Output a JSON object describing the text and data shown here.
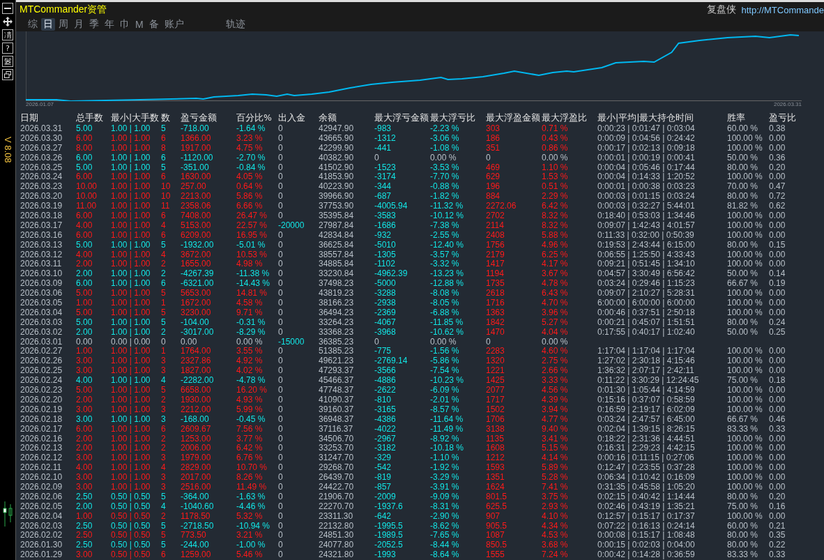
{
  "window": {
    "title": "MTCommander资管",
    "brand": "复盘侠",
    "url": "http://MTCommande"
  },
  "side_toolbar": {
    "buttons": [
      {
        "kind": "minimize"
      },
      {
        "kind": "move"
      },
      {
        "kind": "glyph",
        "label": "凊"
      },
      {
        "kind": "glyph",
        "label": "?"
      },
      {
        "kind": "glyph",
        "label": "鬉"
      },
      {
        "kind": "window"
      }
    ],
    "version": "V 8.08"
  },
  "tabs": [
    {
      "label": "综",
      "selected": false
    },
    {
      "label": "日",
      "selected": true
    },
    {
      "label": "周",
      "selected": false
    },
    {
      "label": "月",
      "selected": false
    },
    {
      "label": "季",
      "selected": false
    },
    {
      "label": "年",
      "selected": false
    },
    {
      "label": "巾",
      "selected": false
    },
    {
      "label": "M",
      "selected": false
    },
    {
      "label": "备",
      "selected": false
    },
    {
      "label": "账户",
      "selected": false
    },
    {
      "label": "轨迹",
      "selected": false
    }
  ],
  "chart": {
    "start_label": "2026.01.07",
    "end_label": "2026.03.31"
  },
  "table": {
    "columns": [
      "日期",
      "总手数",
      "最小|大手数",
      "数",
      "盈亏金额",
      "百分比%",
      "出入金",
      "余额",
      "最大浮亏金额",
      "最大浮亏比",
      "最大浮盈金额",
      "最大浮盈比",
      "最小|平均|最大持仓时间",
      "胜率",
      "盈亏比"
    ],
    "rows": [
      {
        "kind": "loss",
        "transfer": false,
        "floating": true,
        "cells": [
          "2026.03.31",
          "5.00",
          "1.00 | 1.00",
          "5",
          "-718.00",
          "-1.64 %",
          "0",
          "42947.90",
          "-983",
          "-2.23 %",
          "303",
          "0.71 %",
          "0:00:23 | 0:01:47 | 0:03:04",
          "60.00 %",
          "0.38"
        ]
      },
      {
        "kind": "profit",
        "transfer": false,
        "floating": true,
        "cells": [
          "2026.03.30",
          "6.00",
          "1.00 | 1.00",
          "6",
          "1366.00",
          "3.23 %",
          "0",
          "43665.90",
          "-1312",
          "-3.06 %",
          "186",
          "0.43 %",
          "0:00:09 | 0:04:56 | 0:24:42",
          "100.00 %",
          "0.00"
        ]
      },
      {
        "kind": "profit",
        "transfer": false,
        "floating": true,
        "cells": [
          "2026.03.27",
          "8.00",
          "1.00 | 1.00",
          "8",
          "1917.00",
          "4.75 %",
          "0",
          "42299.90",
          "-441",
          "-1.08 %",
          "351",
          "0.86 %",
          "0:00:17 | 0:02:13 | 0:09:18",
          "100.00 %",
          "0.00"
        ]
      },
      {
        "kind": "loss",
        "transfer": false,
        "floating": false,
        "cells": [
          "2026.03.26",
          "6.00",
          "1.00 | 1.00",
          "6",
          "-1120.00",
          "-2.70 %",
          "0",
          "40382.90",
          "0",
          "0.00 %",
          "0",
          "0.00 %",
          "0:00:01 | 0:00:19 | 0:00:41",
          "50.00 %",
          "0.36"
        ]
      },
      {
        "kind": "loss",
        "transfer": false,
        "floating": true,
        "cells": [
          "2026.03.25",
          "5.00",
          "1.00 | 1.00",
          "5",
          "-351.00",
          "-0.84 %",
          "0",
          "41502.90",
          "-1523",
          "-3.53 %",
          "469",
          "1.10 %",
          "0:00:04 | 0:05:46 | 0:17:44",
          "80.00 %",
          "0.20"
        ]
      },
      {
        "kind": "profit",
        "transfer": false,
        "floating": true,
        "cells": [
          "2026.03.24",
          "6.00",
          "1.00 | 1.00",
          "6",
          "1630.00",
          "4.05 %",
          "0",
          "41853.90",
          "-3174",
          "-7.70 %",
          "629",
          "1.53 %",
          "0:00:04 | 0:14:33 | 1:20:52",
          "100.00 %",
          "0.00"
        ]
      },
      {
        "kind": "profit",
        "transfer": false,
        "floating": true,
        "cells": [
          "2026.03.23",
          "10.00",
          "1.00 | 1.00",
          "10",
          "257.00",
          "0.64 %",
          "0",
          "40223.90",
          "-344",
          "-0.88 %",
          "196",
          "0.51 %",
          "0:00:01 | 0:00:38 | 0:03:23",
          "70.00 %",
          "0.47"
        ]
      },
      {
        "kind": "profit",
        "transfer": false,
        "floating": true,
        "cells": [
          "2026.03.20",
          "10.00",
          "1.00 | 1.00",
          "10",
          "2213.00",
          "5.86 %",
          "0",
          "39966.90",
          "-687",
          "-1.82 %",
          "884",
          "2.29 %",
          "0:00:03 | 0:01:15 | 0:03:24",
          "80.00 %",
          "0.72"
        ]
      },
      {
        "kind": "profit",
        "transfer": false,
        "floating": true,
        "cells": [
          "2026.03.19",
          "11.00",
          "1.00 | 1.00",
          "11",
          "2358.06",
          "6.66 %",
          "0",
          "37753.90",
          "-4005.94",
          "-11.32 %",
          "2272.06",
          "6.42 %",
          "0:00:03 | 0:32:27 | 5:44:01",
          "81.82 %",
          "0.62"
        ]
      },
      {
        "kind": "profit",
        "transfer": false,
        "floating": true,
        "cells": [
          "2026.03.18",
          "6.00",
          "1.00 | 1.00",
          "6",
          "7408.00",
          "26.47 %",
          "0",
          "35395.84",
          "-3583",
          "-10.12 %",
          "2702",
          "8.32 %",
          "0:18:40 | 0:53:03 | 1:34:46",
          "100.00 %",
          "0.00"
        ]
      },
      {
        "kind": "profit",
        "transfer": true,
        "floating": true,
        "cells": [
          "2026.03.17",
          "4.00",
          "1.00 | 1.00",
          "4",
          "5153.00",
          "22.57 %",
          "-20000",
          "27987.84",
          "-1686",
          "-7.38 %",
          "2114",
          "8.32 %",
          "0:09:07 | 1:42:43 | 4:01:57",
          "100.00 %",
          "0.00"
        ]
      },
      {
        "kind": "profit",
        "transfer": false,
        "floating": true,
        "cells": [
          "2026.03.16",
          "6.00",
          "1.00 | 1.00",
          "6",
          "6209.00",
          "16.95 %",
          "0",
          "42834.84",
          "-932",
          "-2.55 %",
          "2408",
          "5.88 %",
          "0:11:33 | 0:32:00 | 0:50:39",
          "100.00 %",
          "0.00"
        ]
      },
      {
        "kind": "loss",
        "transfer": false,
        "floating": true,
        "cells": [
          "2026.03.13",
          "5.00",
          "1.00 | 1.00",
          "5",
          "-1932.00",
          "-5.01 %",
          "0",
          "36625.84",
          "-5010",
          "-12.40 %",
          "1756",
          "4.96 %",
          "0:19:53 | 2:43:44 | 6:15:00",
          "80.00 %",
          "0.15"
        ]
      },
      {
        "kind": "profit",
        "transfer": false,
        "floating": true,
        "cells": [
          "2026.03.12",
          "4.00",
          "1.00 | 1.00",
          "4",
          "3672.00",
          "10.53 %",
          "0",
          "38557.84",
          "-1305",
          "-3.57 %",
          "2179",
          "6.25 %",
          "0:06:55 | 1:25:50 | 4:33:43",
          "100.00 %",
          "0.00"
        ]
      },
      {
        "kind": "profit",
        "transfer": false,
        "floating": true,
        "cells": [
          "2026.03.11",
          "2.00",
          "1.00 | 1.00",
          "2",
          "1655.00",
          "4.98 %",
          "0",
          "34885.84",
          "-1102",
          "-3.32 %",
          "1417",
          "4.17 %",
          "0:09:21 | 0:51:45 | 1:34:10",
          "100.00 %",
          "0.00"
        ]
      },
      {
        "kind": "loss",
        "transfer": false,
        "floating": true,
        "cells": [
          "2026.03.10",
          "2.00",
          "1.00 | 1.00",
          "2",
          "-4267.39",
          "-11.38 %",
          "0",
          "33230.84",
          "-4962.39",
          "-13.23 %",
          "1194",
          "3.67 %",
          "0:04:57 | 3:30:49 | 6:56:42",
          "50.00 %",
          "0.14"
        ]
      },
      {
        "kind": "loss",
        "transfer": false,
        "floating": true,
        "cells": [
          "2026.03.09",
          "6.00",
          "1.00 | 1.00",
          "6",
          "-6321.00",
          "-14.43 %",
          "0",
          "37498.23",
          "-5000",
          "-12.88 %",
          "1735",
          "4.78 %",
          "0:03:24 | 0:29:46 | 1:15:23",
          "66.67 %",
          "0.19"
        ]
      },
      {
        "kind": "profit",
        "transfer": false,
        "floating": true,
        "cells": [
          "2026.03.06",
          "5.00",
          "1.00 | 1.00",
          "5",
          "5653.00",
          "14.81 %",
          "0",
          "43819.23",
          "-3288",
          "-8.08 %",
          "2618",
          "6.43 %",
          "0:09:07 | 2:10:27 | 5:28:31",
          "100.00 %",
          "0.00"
        ]
      },
      {
        "kind": "profit",
        "transfer": false,
        "floating": true,
        "cells": [
          "2026.03.05",
          "1.00",
          "1.00 | 1.00",
          "1",
          "1672.00",
          "4.58 %",
          "0",
          "38166.23",
          "-2938",
          "-8.05 %",
          "1716",
          "4.70 %",
          "6:00:00 | 6:00:00 | 6:00:00",
          "100.00 %",
          "0.00"
        ]
      },
      {
        "kind": "profit",
        "transfer": false,
        "floating": true,
        "cells": [
          "2026.03.04",
          "5.00",
          "1.00 | 1.00",
          "5",
          "3230.00",
          "9.71 %",
          "0",
          "36494.23",
          "-2369",
          "-6.88 %",
          "1363",
          "3.96 %",
          "0:00:46 | 0:37:51 | 2:50:18",
          "100.00 %",
          "0.00"
        ]
      },
      {
        "kind": "loss",
        "transfer": false,
        "floating": true,
        "cells": [
          "2026.03.03",
          "5.00",
          "1.00 | 1.00",
          "5",
          "-104.00",
          "-0.31 %",
          "0",
          "33264.23",
          "-4067",
          "-11.85 %",
          "1842",
          "5.27 %",
          "0:00:21 | 0:45:07 | 1:51:51",
          "80.00 %",
          "0.24"
        ]
      },
      {
        "kind": "loss",
        "transfer": false,
        "floating": true,
        "cells": [
          "2026.03.02",
          "2.00",
          "1.00 | 1.00",
          "2",
          "-3017.00",
          "-8.29 %",
          "0",
          "33368.23",
          "-3968",
          "-10.62 %",
          "1470",
          "4.04 %",
          "0:17:55 | 0:40:17 | 1:02:40",
          "50.00 %",
          "0.25"
        ]
      },
      {
        "kind": "flat",
        "transfer": true,
        "floating": false,
        "cells": [
          "2026.03.01",
          "0.00",
          "0.00 | 0.00",
          "0",
          "0.00",
          "0.00 %",
          "-15000",
          "36385.23",
          "0",
          "0.00 %",
          "0",
          "0.00 %"
        ]
      },
      {
        "kind": "profit",
        "transfer": false,
        "floating": true,
        "cells": [
          "2026.02.27",
          "1.00",
          "1.00 | 1.00",
          "1",
          "1764.00",
          "3.55 %",
          "0",
          "51385.23",
          "-775",
          "-1.56 %",
          "2283",
          "4.60 %",
          "1:17:04 | 1:17:04 | 1:17:04",
          "100.00 %",
          "0.00"
        ]
      },
      {
        "kind": "profit",
        "transfer": false,
        "floating": true,
        "cells": [
          "2026.02.26",
          "3.00",
          "1.00 | 1.00",
          "3",
          "2327.86",
          "4.92 %",
          "0",
          "49621.23",
          "-2769.14",
          "-5.86 %",
          "1320",
          "2.75 %",
          "1:27:02 | 2:30:18 | 4:15:46",
          "100.00 %",
          "0.00"
        ]
      },
      {
        "kind": "profit",
        "transfer": false,
        "floating": true,
        "cells": [
          "2026.02.25",
          "3.00",
          "1.00 | 1.00",
          "3",
          "1827.00",
          "4.02 %",
          "0",
          "47293.37",
          "-3566",
          "-7.54 %",
          "1221",
          "2.66 %",
          "1:36:32 | 2:07:17 | 2:42:11",
          "100.00 %",
          "0.00"
        ]
      },
      {
        "kind": "loss",
        "transfer": false,
        "floating": true,
        "cells": [
          "2026.02.24",
          "4.00",
          "1.00 | 1.00",
          "4",
          "-2282.00",
          "-4.78 %",
          "0",
          "45466.37",
          "-4886",
          "-10.23 %",
          "1425",
          "3.33 %",
          "0:11:22 | 3:30:29 | 12:24:45",
          "75.00 %",
          "0.18"
        ]
      },
      {
        "kind": "profit",
        "transfer": false,
        "floating": true,
        "cells": [
          "2026.02.23",
          "5.00",
          "1.00 | 1.00",
          "5",
          "6658.00",
          "16.20 %",
          "0",
          "47748.37",
          "-2622",
          "-6.09 %",
          "2077",
          "4.56 %",
          "0:01:30 | 1:05:44 | 4:14:59",
          "100.00 %",
          "0.00"
        ]
      },
      {
        "kind": "profit",
        "transfer": false,
        "floating": true,
        "cells": [
          "2026.02.20",
          "2.00",
          "1.00 | 1.00",
          "2",
          "1930.00",
          "4.93 %",
          "0",
          "41090.37",
          "-810",
          "-2.01 %",
          "1717",
          "4.39 %",
          "0:15:16 | 0:37:07 | 0:58:59",
          "100.00 %",
          "0.00"
        ]
      },
      {
        "kind": "profit",
        "transfer": false,
        "floating": true,
        "cells": [
          "2026.02.19",
          "3.00",
          "1.00 | 1.00",
          "3",
          "2212.00",
          "5.99 %",
          "0",
          "39160.37",
          "-3165",
          "-8.57 %",
          "1502",
          "3.94 %",
          "0:16:59 | 2:19:17 | 6:02:09",
          "100.00 %",
          "0.00"
        ]
      },
      {
        "kind": "loss",
        "transfer": false,
        "floating": true,
        "cells": [
          "2026.02.18",
          "3.00",
          "1.00 | 1.00",
          "3",
          "-168.00",
          "-0.45 %",
          "0",
          "36948.37",
          "-4386",
          "-11.64 %",
          "1706",
          "4.77 %",
          "0:03:24 | 2:47:57 | 6:45:00",
          "66.67 %",
          "0.46"
        ]
      },
      {
        "kind": "profit",
        "transfer": false,
        "floating": true,
        "cells": [
          "2026.02.17",
          "6.00",
          "1.00 | 1.00",
          "6",
          "2609.67",
          "7.56 %",
          "0",
          "37116.37",
          "-4022",
          "-11.49 %",
          "3138",
          "9.40 %",
          "0:02:04 | 1:39:15 | 8:26:15",
          "83.33 %",
          "0.33"
        ]
      },
      {
        "kind": "profit",
        "transfer": false,
        "floating": true,
        "cells": [
          "2026.02.16",
          "2.00",
          "1.00 | 1.00",
          "2",
          "1253.00",
          "3.77 %",
          "0",
          "34506.70",
          "-2967",
          "-8.92 %",
          "1135",
          "3.41 %",
          "0:18:22 | 2:31:36 | 4:44:51",
          "100.00 %",
          "0.00"
        ]
      },
      {
        "kind": "profit",
        "transfer": false,
        "floating": true,
        "cells": [
          "2026.02.13",
          "2.00",
          "1.00 | 1.00",
          "2",
          "2006.00",
          "6.42 %",
          "0",
          "33253.70",
          "-3182",
          "-10.18 %",
          "1608",
          "5.15 %",
          "0:16:31 | 2:29:23 | 4:42:15",
          "100.00 %",
          "0.00"
        ]
      },
      {
        "kind": "profit",
        "transfer": false,
        "floating": true,
        "cells": [
          "2026.02.12",
          "3.00",
          "1.00 | 1.00",
          "3",
          "1979.00",
          "6.76 %",
          "0",
          "31247.70",
          "-329",
          "-1.10 %",
          "1212",
          "4.14 %",
          "0:00:16 | 0:11:15 | 0:27:06",
          "100.00 %",
          "0.00"
        ]
      },
      {
        "kind": "profit",
        "transfer": false,
        "floating": true,
        "cells": [
          "2026.02.11",
          "4.00",
          "1.00 | 1.00",
          "4",
          "2829.00",
          "10.70 %",
          "0",
          "29268.70",
          "-542",
          "-1.92 %",
          "1593",
          "5.89 %",
          "0:12:47 | 0:23:55 | 0:37:28",
          "100.00 %",
          "0.00"
        ]
      },
      {
        "kind": "profit",
        "transfer": false,
        "floating": true,
        "cells": [
          "2026.02.10",
          "3.00",
          "1.00 | 1.00",
          "3",
          "2017.00",
          "8.26 %",
          "0",
          "26439.70",
          "-819",
          "-3.29 %",
          "1351",
          "5.28 %",
          "0:06:34 | 0:10:42 | 0:16:09",
          "100.00 %",
          "0.00"
        ]
      },
      {
        "kind": "profit",
        "transfer": false,
        "floating": true,
        "cells": [
          "2026.02.09",
          "3.00",
          "1.00 | 1.00",
          "3",
          "2516.00",
          "11.49 %",
          "0",
          "24422.70",
          "-857",
          "-3.91 %",
          "1624",
          "7.41 %",
          "0:31:35 | 0:45:58 | 1:05:20",
          "100.00 %",
          "0.00"
        ]
      },
      {
        "kind": "loss",
        "transfer": false,
        "floating": true,
        "cells": [
          "2026.02.06",
          "2.50",
          "0.50 | 0.50",
          "5",
          "-364.00",
          "-1.63 %",
          "0",
          "21906.70",
          "-2009",
          "-9.09 %",
          "801.5",
          "3.75 %",
          "0:02:15 | 0:40:42 | 1:14:44",
          "80.00 %",
          "0.20"
        ]
      },
      {
        "kind": "loss",
        "transfer": false,
        "floating": true,
        "cells": [
          "2026.02.05",
          "2.00",
          "0.50 | 0.50",
          "4",
          "-1040.60",
          "-4.46 %",
          "0",
          "22270.70",
          "-1937.6",
          "-8.31 %",
          "625.5",
          "2.93 %",
          "0:02:46 | 0:43:19 | 1:35:21",
          "75.00 %",
          "0.16"
        ]
      },
      {
        "kind": "profit",
        "transfer": false,
        "floating": true,
        "cells": [
          "2026.02.04",
          "1.00",
          "0.50 | 0.50",
          "2",
          "1178.50",
          "5.32 %",
          "0",
          "23311.30",
          "-642",
          "-2.90 %",
          "907",
          "4.10 %",
          "0:12:57 | 0:15:17 | 0:17:37",
          "100.00 %",
          "0.00"
        ]
      },
      {
        "kind": "loss",
        "transfer": false,
        "floating": true,
        "cells": [
          "2026.02.03",
          "2.50",
          "0.50 | 0.50",
          "5",
          "-2718.50",
          "-10.94 %",
          "0",
          "22132.80",
          "-1995.5",
          "-8.62 %",
          "905.5",
          "4.34 %",
          "0:07:22 | 0:16:13 | 0:24:14",
          "60.00 %",
          "0.21"
        ]
      },
      {
        "kind": "profit",
        "transfer": false,
        "floating": true,
        "cells": [
          "2026.02.02",
          "2.50",
          "0.50 | 0.50",
          "5",
          "773.50",
          "3.21 %",
          "0",
          "24851.30",
          "-1989.5",
          "-7.65 %",
          "1087",
          "4.53 %",
          "0:00:08 | 0:15:17 | 1:08:48",
          "80.00 %",
          "0.35"
        ]
      },
      {
        "kind": "loss",
        "transfer": false,
        "floating": true,
        "cells": [
          "2026.01.30",
          "2.50",
          "0.50 | 0.50",
          "5",
          "-244.00",
          "-1.00 %",
          "0",
          "24077.80",
          "-2052.5",
          "-8.44 %",
          "850.5",
          "3.68 %",
          "0:00:15 | 0:02:03 | 0:04:00",
          "80.00 %",
          "0.22"
        ]
      },
      {
        "kind": "profit",
        "transfer": false,
        "floating": true,
        "cells": [
          "2026.01.29",
          "3.00",
          "0.50 | 0.50",
          "6",
          "1259.00",
          "5.46 %",
          "0",
          "24321.80",
          "-1993",
          "-8.64 %",
          "1555",
          "7.24 %",
          "0:00:42 | 0:14:28 | 0:36:59",
          "83.33 %",
          "0.33"
        ]
      }
    ]
  }
}
